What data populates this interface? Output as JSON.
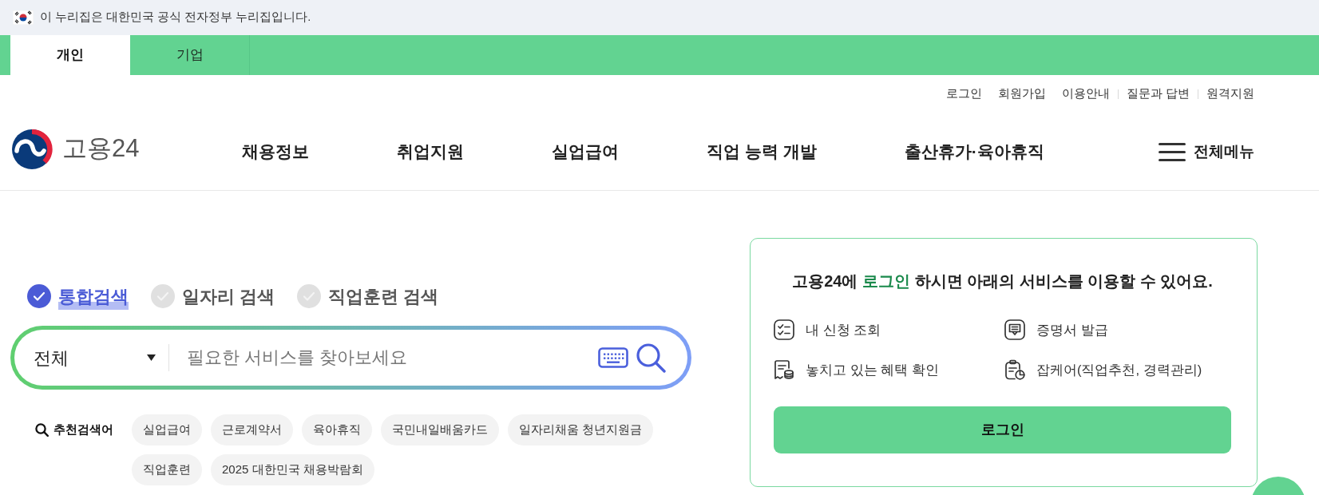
{
  "gov_banner": {
    "text": "이 누리집은 대한민국 공식 전자정부 누리집입니다."
  },
  "audience_tabs": [
    {
      "label": "개인",
      "selected": true
    },
    {
      "label": "기업",
      "selected": false
    }
  ],
  "utility_links": [
    {
      "label": "로그인",
      "divider_before": false
    },
    {
      "label": "회원가입",
      "divider_before": false
    },
    {
      "label": "이용안내",
      "divider_before": false
    },
    {
      "label": "질문과 답변",
      "divider_before": true
    },
    {
      "label": "원격지원",
      "divider_before": true
    }
  ],
  "logo": {
    "text": "고용24"
  },
  "main_nav": [
    "채용정보",
    "취업지원",
    "실업급여",
    "직업 능력 개발",
    "출산휴가·육아휴직"
  ],
  "all_menu": {
    "label": "전체메뉴"
  },
  "search": {
    "scopes": [
      {
        "label": "통합검색",
        "selected": true
      },
      {
        "label": "일자리 검색",
        "selected": false
      },
      {
        "label": "직업훈련 검색",
        "selected": false
      }
    ],
    "category": "전체",
    "placeholder": "필요한 서비스를 찾아보세요",
    "recommended_label": "추천검색어",
    "recommended": [
      "실업급여",
      "근로계약서",
      "육아휴직",
      "국민내일배움카드",
      "일자리채움 청년지원금",
      "직업훈련",
      "2025 대한민국 채용박람회"
    ]
  },
  "login_card": {
    "title": [
      {
        "text": "고용24에 ",
        "highlight": false
      },
      {
        "text": "로그인",
        "highlight": true
      },
      {
        "text": " 하시면 아래의 서비스를 이용할 수 있어요.",
        "highlight": false
      }
    ],
    "services": [
      "내 신청 조회",
      "증명서 발급",
      "놓치고 있는 혜택 확인",
      "잡케어(직업추천, 경력관리)"
    ],
    "button": "로그인"
  }
}
